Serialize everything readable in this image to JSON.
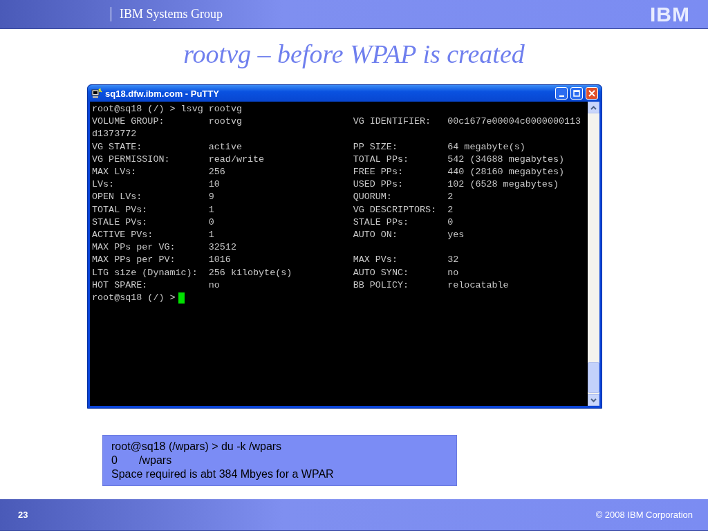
{
  "header": {
    "group": "IBM Systems Group",
    "logo": "IBM"
  },
  "slide_title": "rootvg – before WPAP is created",
  "window": {
    "title": "sq18.dfw.ibm.com - PuTTY",
    "lines": [
      {
        "cells": [
          "root@sq18 (/) > lsvg rootvg"
        ]
      },
      {
        "cells": [
          "VOLUME GROUP:",
          "rootvg",
          "VG IDENTIFIER:",
          "00c1677e00004c0000000113"
        ]
      },
      {
        "cells": [
          "d1373772"
        ]
      },
      {
        "cells": [
          "VG STATE:",
          "active",
          "PP SIZE:",
          "64 megabyte(s)"
        ]
      },
      {
        "cells": [
          "VG PERMISSION:",
          "read/write",
          "TOTAL PPs:",
          "542 (34688 megabytes)"
        ]
      },
      {
        "cells": [
          "MAX LVs:",
          "256",
          "FREE PPs:",
          "440 (28160 megabytes)"
        ]
      },
      {
        "cells": [
          "LVs:",
          "10",
          "USED PPs:",
          "102 (6528 megabytes)"
        ]
      },
      {
        "cells": [
          "OPEN LVs:",
          "9",
          "QUORUM:",
          "2"
        ]
      },
      {
        "cells": [
          "TOTAL PVs:",
          "1",
          "VG DESCRIPTORS:",
          "2"
        ]
      },
      {
        "cells": [
          "STALE PVs:",
          "0",
          "STALE PPs:",
          "0"
        ]
      },
      {
        "cells": [
          "ACTIVE PVs:",
          "1",
          "AUTO ON:",
          "yes"
        ]
      },
      {
        "cells": [
          "MAX PPs per VG:",
          "32512"
        ]
      },
      {
        "cells": [
          "MAX PPs per PV:",
          "1016",
          "MAX PVs:",
          "32"
        ]
      },
      {
        "cells": [
          "LTG size (Dynamic):",
          "256 kilobyte(s)",
          "AUTO SYNC:",
          "no"
        ]
      },
      {
        "cells": [
          "HOT SPARE:",
          "no",
          "BB POLICY:",
          "relocatable"
        ]
      },
      {
        "cells": [
          "root@sq18 (/) >"
        ],
        "cursor": true
      }
    ]
  },
  "note": [
    "root@sq18 (/wpars) > du -k /wpars",
    "0       /wpars",
    "Space required is abt 384 Mbyes for a WPAR"
  ],
  "footer": {
    "page": "23",
    "copyright": "© 2008 IBM Corporation"
  }
}
